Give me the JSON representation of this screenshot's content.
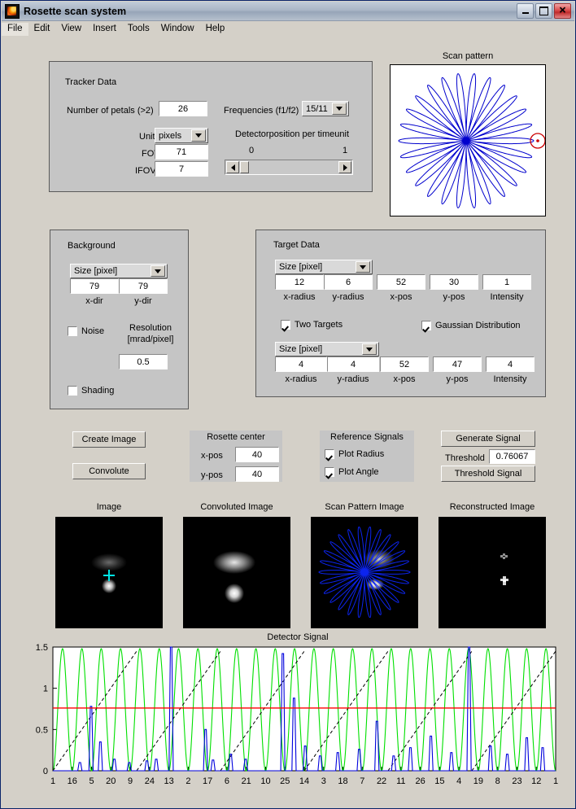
{
  "window": {
    "title": "Rosette scan system",
    "icon": "matlab-icon",
    "buttons": {
      "minimize": "minimize-button",
      "maximize": "maximize-button",
      "close": "close-button"
    }
  },
  "menu": {
    "items": [
      "File",
      "Edit",
      "View",
      "Insert",
      "Tools",
      "Window",
      "Help"
    ],
    "selected": "File"
  },
  "tracker": {
    "title": "Tracker Data",
    "petals_label": "Number of petals  (>2)",
    "petals_value": "26",
    "frequencies_label": "Frequencies (f1/f2)",
    "frequencies_value": "15/11",
    "unit_label": "Unit",
    "unit_value": "pixels",
    "fov_label": "FOV",
    "fov_value": "71",
    "ifov_label": "IFOV",
    "ifov_value": "7",
    "detector_label": "Detectorposition per timeunit",
    "slider_min": "0",
    "slider_max": "1"
  },
  "scan_pattern": {
    "title": "Scan pattern",
    "petals": 26
  },
  "background": {
    "title": "Background",
    "size_select": "Size [pixel]",
    "x_value": "79",
    "y_value": "79",
    "x_label": "x-dir",
    "y_label": "y-dir",
    "noise_label": "Noise",
    "noise_checked": false,
    "resolution_label_1": "Resolution",
    "resolution_label_2": "[mrad/pixel]",
    "resolution_value": "0.5",
    "shading_label": "Shading",
    "shading_checked": false
  },
  "target": {
    "title": "Target Data",
    "size_select_1": "Size [pixel]",
    "size_select_2": "Size [pixel]",
    "labels": [
      "x-radius",
      "y-radius",
      "x-pos",
      "y-pos",
      "Intensity"
    ],
    "target1": {
      "x_radius": "12",
      "y_radius": "6",
      "x_pos": "52",
      "y_pos": "30",
      "intensity": "1"
    },
    "target2": {
      "x_radius": "4",
      "y_radius": "4",
      "x_pos": "52",
      "y_pos": "47",
      "intensity": "4"
    },
    "two_targets_label": "Two Targets",
    "two_targets_checked": true,
    "gaussian_label": "Gaussian Distribution",
    "gaussian_checked": true
  },
  "actions": {
    "create_image": "Create Image",
    "convolute": "Convolute",
    "generate_signal": "Generate Signal",
    "threshold_label": "Threshold",
    "threshold_value": "0.76067",
    "threshold_signal": "Threshold Signal"
  },
  "rosette_center": {
    "title": "Rosette center",
    "x_label": "x-pos",
    "x_value": "40",
    "y_label": "y-pos",
    "y_value": "40"
  },
  "reference_signals": {
    "title": "Reference Signals",
    "plot_radius_label": "Plot Radius",
    "plot_radius_checked": true,
    "plot_angle_label": "Plot Angle",
    "plot_angle_checked": true
  },
  "thumbnails": [
    {
      "title": "Image",
      "name": "image-axes"
    },
    {
      "title": "Convoluted Image",
      "name": "convoluted-image-axes"
    },
    {
      "title": "Scan Pattern Image",
      "name": "scan-pattern-image-axes"
    },
    {
      "title": "Reconstructed Image",
      "name": "reconstructed-image-axes"
    }
  ],
  "chart_data": {
    "type": "line",
    "title": "Detector Signal",
    "xlabel": "",
    "ylabel": "",
    "xlim": [
      0,
      27
    ],
    "ylim": [
      0,
      1.5
    ],
    "ytick_labels": [
      "0",
      "0.5",
      "1",
      "1.5"
    ],
    "ytick_values": [
      0,
      0.5,
      1,
      1.5
    ],
    "xtick_labels": [
      "1",
      "16",
      "5",
      "20",
      "9",
      "24",
      "13",
      "2",
      "17",
      "6",
      "21",
      "10",
      "25",
      "14",
      "3",
      "18",
      "7",
      "22",
      "11",
      "26",
      "15",
      "4",
      "19",
      "8",
      "23",
      "12",
      "1"
    ],
    "grid": false,
    "legend": "none",
    "annotations": [
      {
        "name": "threshold-line",
        "type": "hline",
        "value": 0.76067,
        "color": "#ff0000"
      }
    ],
    "series": [
      {
        "name": "Plot Radius (reference radius signal)",
        "color": "#00ff00",
        "style": "solid",
        "description": "Raised sinusoid oscillating between 0 and 1.5, 26 cycles across the record",
        "cycles": 26,
        "min": 0.0,
        "max": 1.48
      },
      {
        "name": "Plot Angle (reference angle signal)",
        "color": "#000000",
        "style": "dashed",
        "description": "Sawtooth ramp rising from 0 to about 1.45 then resetting, 6 ramps across the record",
        "ramps": 6,
        "min": 0.0,
        "max": 1.45
      },
      {
        "name": "Detector signal",
        "color": "#0000ff",
        "style": "solid",
        "description": "Sparse narrow spikes on a near-zero baseline; tallest spikes reach 1.5 near samples 12 and 22",
        "min": 0.0,
        "max": 1.5,
        "spikes": [
          {
            "x": 1.45,
            "h": 0.1
          },
          {
            "x": 2.05,
            "h": 0.78
          },
          {
            "x": 2.55,
            "h": 0.35
          },
          {
            "x": 3.3,
            "h": 0.14
          },
          {
            "x": 4.1,
            "h": 0.1
          },
          {
            "x": 5.05,
            "h": 0.12
          },
          {
            "x": 5.55,
            "h": 0.14
          },
          {
            "x": 6.35,
            "h": 1.5
          },
          {
            "x": 8.2,
            "h": 0.5
          },
          {
            "x": 8.6,
            "h": 0.13
          },
          {
            "x": 9.55,
            "h": 0.2
          },
          {
            "x": 10.35,
            "h": 0.14
          },
          {
            "x": 12.35,
            "h": 1.42
          },
          {
            "x": 12.95,
            "h": 0.88
          },
          {
            "x": 13.55,
            "h": 0.3
          },
          {
            "x": 14.35,
            "h": 0.18
          },
          {
            "x": 15.3,
            "h": 0.22
          },
          {
            "x": 16.45,
            "h": 0.26
          },
          {
            "x": 17.4,
            "h": 0.6
          },
          {
            "x": 18.3,
            "h": 0.18
          },
          {
            "x": 19.2,
            "h": 0.28
          },
          {
            "x": 20.3,
            "h": 0.42
          },
          {
            "x": 21.4,
            "h": 0.22
          },
          {
            "x": 22.35,
            "h": 1.5
          },
          {
            "x": 23.5,
            "h": 0.3
          },
          {
            "x": 24.4,
            "h": 0.2
          },
          {
            "x": 25.45,
            "h": 0.4
          },
          {
            "x": 26.3,
            "h": 0.28
          }
        ]
      }
    ]
  }
}
